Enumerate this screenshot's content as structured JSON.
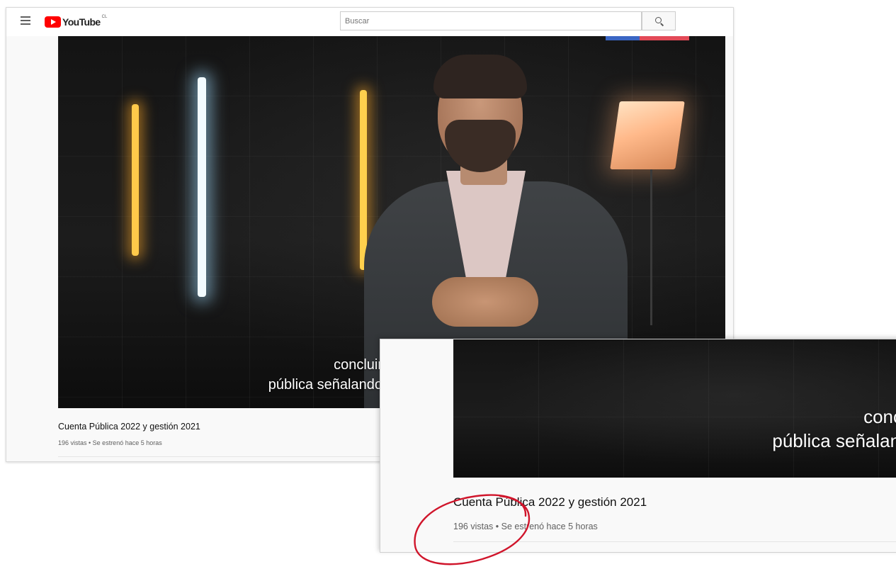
{
  "masthead": {
    "logo_text": "YouTube",
    "country_code": "CL",
    "search_placeholder": "Buscar",
    "icons": {
      "menu": "hamburger-menu-icon",
      "search": "search-icon",
      "logo": "youtube-logo-icon"
    }
  },
  "video": {
    "caption_line1": "concluir",
    "caption_line2": "pública señalando",
    "title": "Cuenta Pública 2022 y gestión 2021",
    "meta": "196 vistas • Se estrenó hace 5 horas"
  },
  "zoom": {
    "caption_line1": "conclui",
    "caption_line2": "pública señalando",
    "title": "Cuenta Pública 2022 y gestión 2021",
    "meta": "196 vistas • Se estrenó hace 5 horas"
  },
  "colors": {
    "brand_red": "#ff0000",
    "highlight_annotation": "#d0152b",
    "flag_blue": "#3a66c4",
    "flag_red": "#e34a57"
  }
}
